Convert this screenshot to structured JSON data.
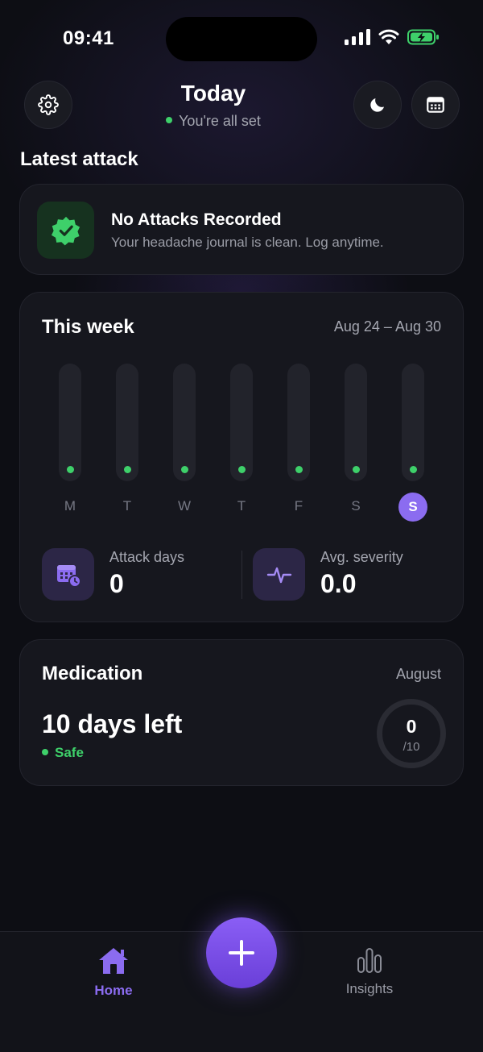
{
  "status_bar": {
    "time": "09:41"
  },
  "header": {
    "title": "Today",
    "subtitle": "You're all set",
    "settings_icon": "gear-icon",
    "theme_icon": "moon-icon",
    "calendar_icon": "calendar-icon"
  },
  "latest": {
    "section_title": "Latest attack",
    "title": "No Attacks Recorded",
    "subtitle": "Your headache journal is clean. Log anytime.",
    "icon": "verified-badge-icon"
  },
  "week": {
    "title": "This week",
    "range": "Aug 24 – Aug 30",
    "days": [
      "M",
      "T",
      "W",
      "T",
      "F",
      "S",
      "S"
    ],
    "today_index": 6,
    "stats": {
      "attack_days_label": "Attack days",
      "attack_days_value": "0",
      "severity_label": "Avg. severity",
      "severity_value": "0.0"
    }
  },
  "medication": {
    "title": "Medication",
    "month": "August",
    "days_left": "10 days left",
    "status": "Safe",
    "used": "0",
    "max": "/10"
  },
  "tabs": {
    "home": "Home",
    "insights": "Insights",
    "add_icon": "plus-icon"
  },
  "colors": {
    "accent": "#8b6cf0",
    "success": "#3ed06a",
    "background": "#0d0e14",
    "card": "#16171e"
  }
}
